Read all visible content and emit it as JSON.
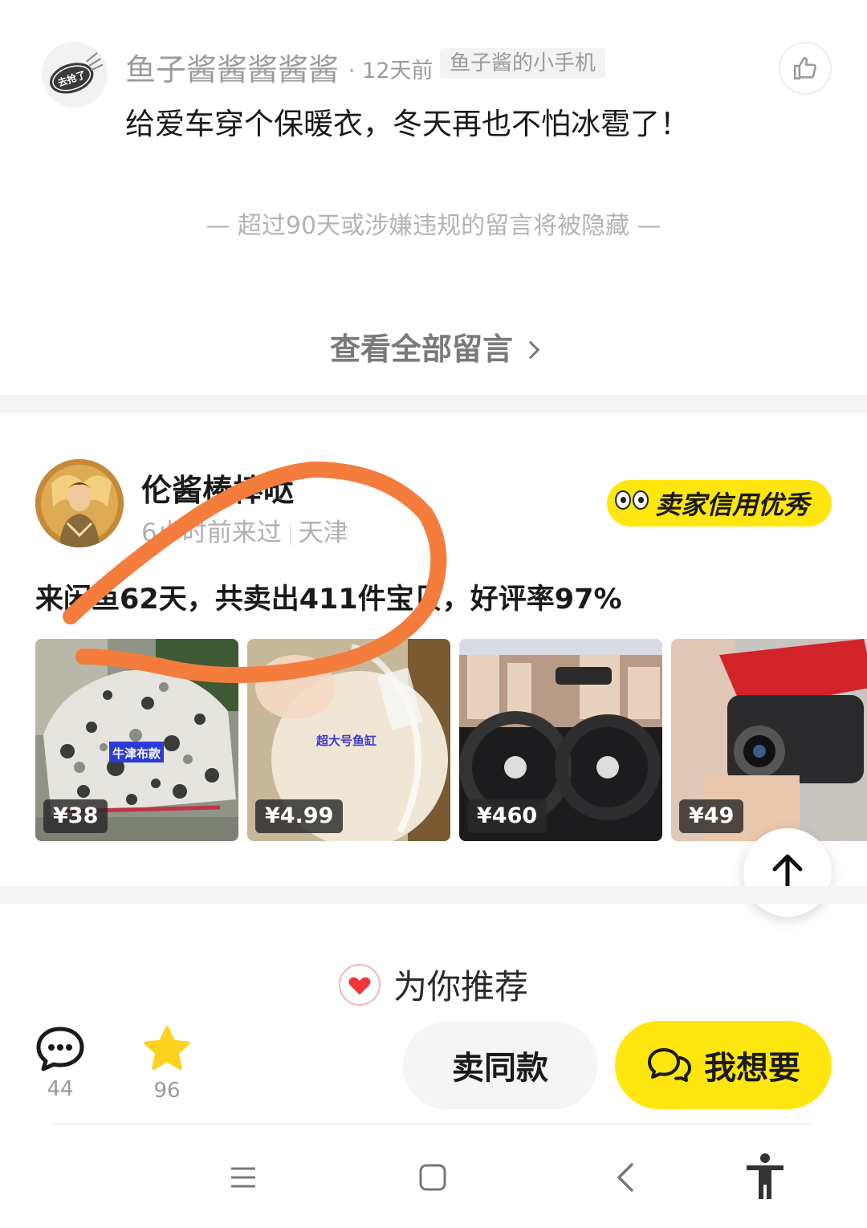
{
  "comment": {
    "user_name": "鱼子酱酱酱酱酱",
    "time": "· 12天前",
    "tag": "鱼子酱的小手机",
    "avatar_text": "去抢了",
    "text": "给爱车穿个保暖衣，冬天再也不怕冰雹了！",
    "notice": "— 超过90天或涉嫌违规的留言将被隐藏 —",
    "view_all": "查看全部留言"
  },
  "seller": {
    "name": "伦酱棒棒哒",
    "last_seen": "6小时前来过",
    "location": "天津",
    "credit_badge": "卖家信用优秀",
    "stats": "来闲鱼62天，共卖出411件宝贝，好评率97%",
    "items": [
      {
        "price": "¥38",
        "label": "牛津布款"
      },
      {
        "price": "¥4.99",
        "label": "超大号鱼缸"
      },
      {
        "price": "¥460",
        "label": ""
      },
      {
        "price": "¥49",
        "label": ""
      }
    ]
  },
  "recommend": {
    "title": "为你推荐"
  },
  "actions": {
    "comment_count": "44",
    "favorite_count": "96",
    "sell_same": "卖同款",
    "want": "我想要"
  },
  "colors": {
    "brand_yellow": "#ffe60f",
    "annotation_orange": "#f47c3c",
    "heart_red": "#f0353b"
  }
}
